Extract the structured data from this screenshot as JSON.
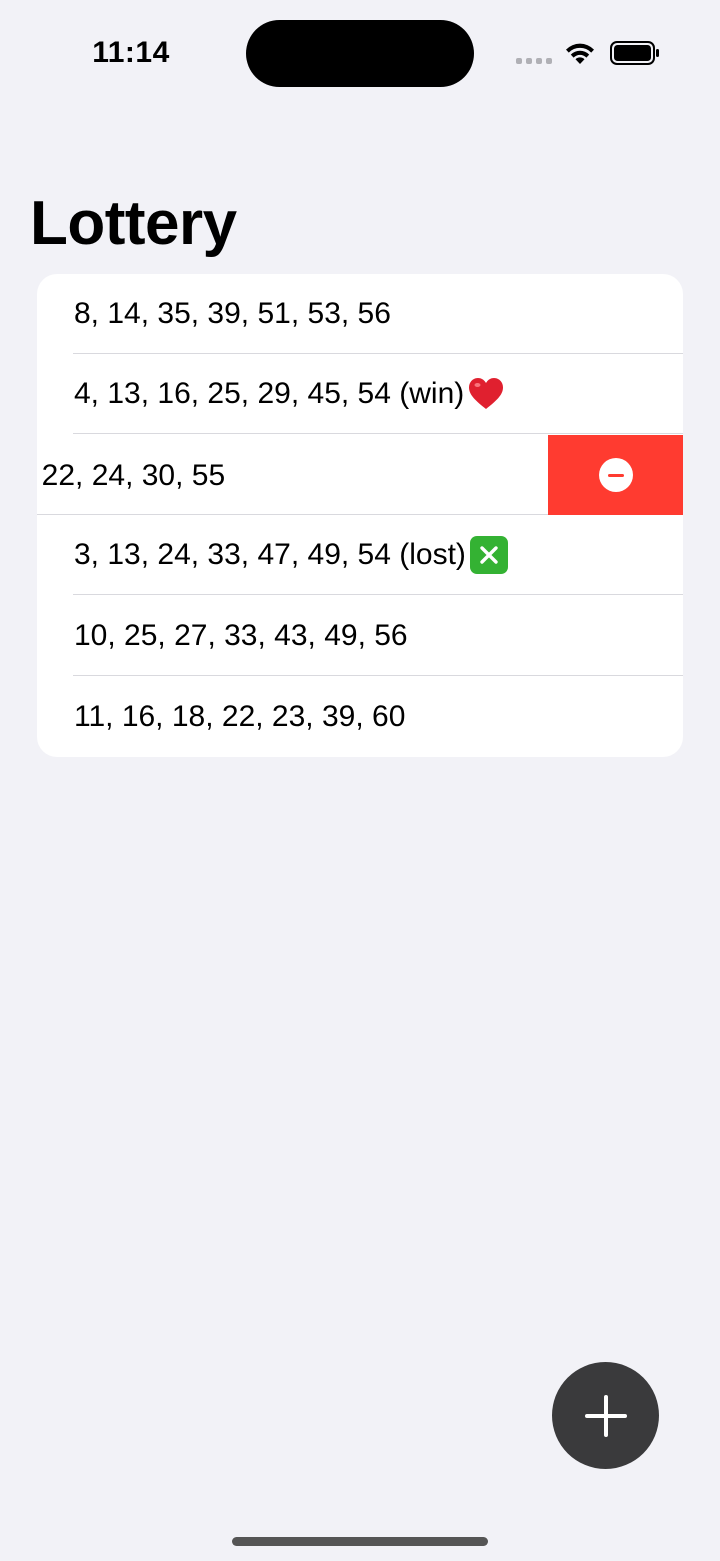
{
  "status_bar": {
    "time": "11:14"
  },
  "title": "Lottery",
  "tickets": [
    {
      "numbers": "8, 14, 35, 39, 51, 53, 56",
      "emoji": ""
    },
    {
      "numbers": "4, 13, 16, 25, 29, 45, 54 (win)",
      "emoji": "heart-icon"
    },
    {
      "numbers": ", 22, 24, 30, 55",
      "emoji": "",
      "swiped": true
    },
    {
      "numbers": "3, 13, 24, 33, 47, 49, 54 (lost)",
      "emoji": "cross-mark-icon"
    },
    {
      "numbers": "10, 25, 27, 33, 43, 49, 56",
      "emoji": ""
    },
    {
      "numbers": "11, 16, 18, 22, 23, 39, 60",
      "emoji": ""
    }
  ],
  "colors": {
    "background": "#f2f2f7",
    "card": "#ffffff",
    "delete_action": "#ff3b30",
    "fab": "#3a3a3c",
    "win_heart": "#e0202f",
    "lost_mark": "#34b233"
  },
  "icons": {
    "delete_action": "minus-circle-icon",
    "fab": "plus-icon"
  }
}
